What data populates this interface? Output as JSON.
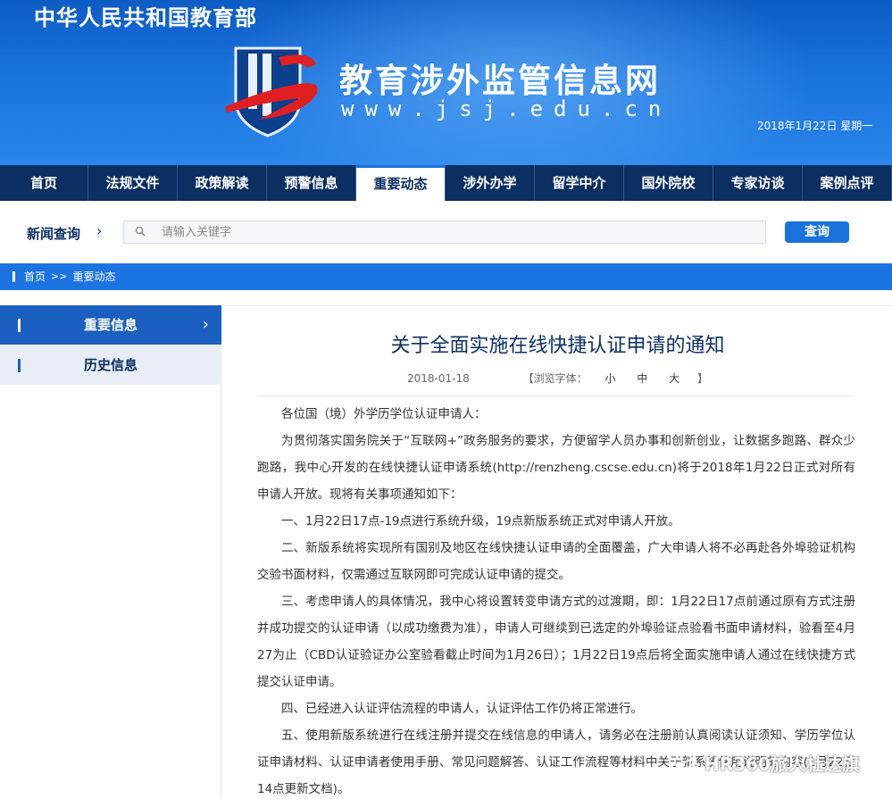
{
  "header": {
    "ministry": "中华人民共和国教育部",
    "site_title": "教育涉外监管信息网",
    "site_url": "www.jsj.edu.cn",
    "date": "2018年1月22日 星期一",
    "colors": {
      "primary": "#1a72dc",
      "nav": "#0c2f62",
      "logo_red": "#e02020"
    }
  },
  "nav": {
    "items": [
      "首页",
      "法规文件",
      "政策解读",
      "预警信息",
      "重要动态",
      "涉外办学",
      "留学中介",
      "国外院校",
      "专家访谈",
      "案例点评"
    ],
    "active": "重要动态"
  },
  "search": {
    "label": "新闻查询",
    "placeholder": "请输入关键字",
    "button": "查询",
    "icon": "search-icon"
  },
  "breadcrumb": {
    "home": "首页",
    "separator": ">>",
    "current": "重要动态"
  },
  "sidebar": {
    "items": [
      {
        "label": "重要信息",
        "active": true
      },
      {
        "label": "历史信息",
        "active": false
      }
    ]
  },
  "article": {
    "title": "关于全面实施在线快捷认证申请的通知",
    "date": "2018-01-18",
    "font_label": "【浏览字体：",
    "font_small": "小",
    "font_medium": "中",
    "font_large": "大",
    "font_close": "】",
    "paragraphs": [
      "各位国（境）外学历学位认证申请人：",
      "为贯彻落实国务院关于“互联网+”政务服务的要求，方便留学人员办事和创新创业，让数据多跑路、群众少跑路，我中心开发的在线快捷认证申请系统(http://renzheng.cscse.edu.cn)将于2018年1月22日正式对所有申请人开放。现将有关事项通知如下：",
      "一、1月22日17点-19点进行系统升级，19点新版系统正式对申请人开放。",
      "二、新版系统将实现所有国别及地区在线快捷认证申请的全面覆盖，广大申请人将不必再赴各外埠验证机构交验书面材料，仅需通过互联网即可完成认证申请的提交。",
      "三、考虑申请人的具体情况，我中心将设置转变申请方式的过渡期，即：1月22日17点前通过原有方式注册并成功提交的认证申请（以成功缴费为准），申请人可继续到已选定的外埠验证点验看书面申请材料，验看至4月27为止（CBD认证验证办公室验看截止时间为1月26日）；1月22日19点后将全面实施申请人通过在线快捷方式提交认证申请。",
      "四、已经进入认证评估流程的申请人，认证评估工作仍将正常进行。",
      "五、使用新版系统进行在线注册并提交在线信息的申请人，请务必在注册前认真阅读认证须知、学历学位认证申请材料、认证申请者使用手册、常见问题解答、认证工作流程等材料中关于新系统使用说明的内容(1月22日14点更新文档)。"
    ]
  },
  "watermark": {
    "text": "HR360旅人杜达旗"
  }
}
